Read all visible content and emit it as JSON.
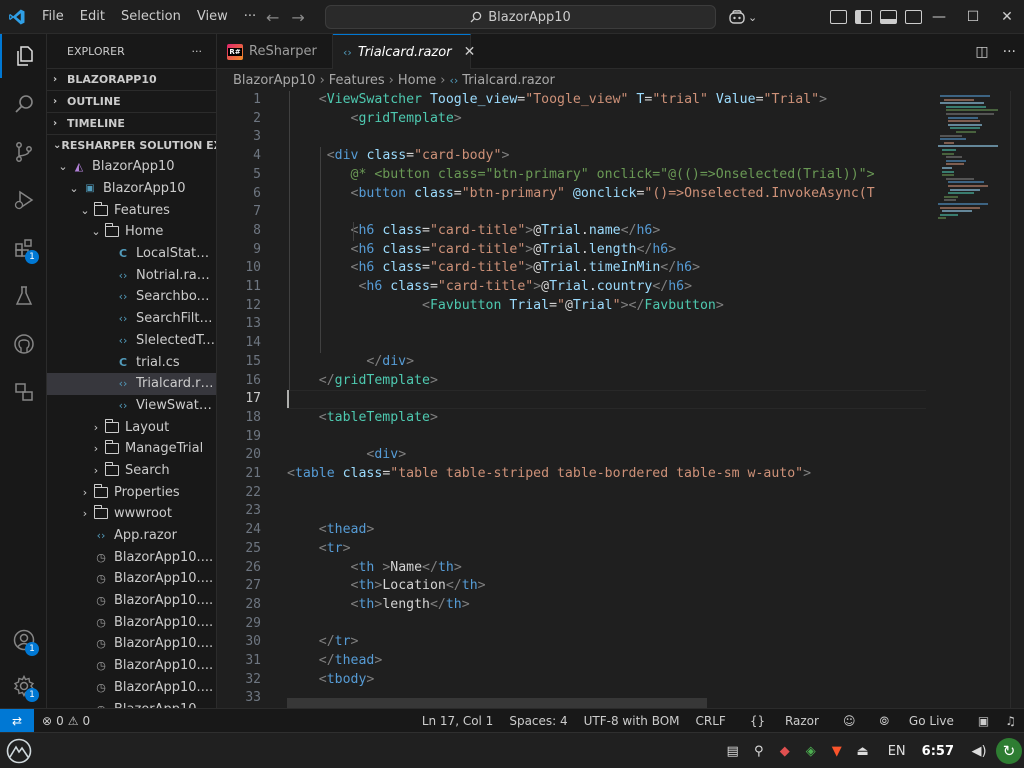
{
  "titlebar": {
    "menu": [
      "File",
      "Edit",
      "Selection",
      "View",
      "···"
    ],
    "search": "BlazorApp10"
  },
  "explorer": {
    "header": "EXPLORER",
    "sections": [
      "BLAZORAPP10",
      "OUTLINE",
      "TIMELINE",
      "RESHARPER SOLUTION EXPL..."
    ],
    "tree": [
      {
        "label": "BlazorApp10",
        "kind": "solution",
        "level": 1,
        "chev": "open"
      },
      {
        "label": "BlazorApp10",
        "kind": "project",
        "level": 2,
        "chev": "open"
      },
      {
        "label": "Features",
        "kind": "folder",
        "level": 3,
        "chev": "open"
      },
      {
        "label": "Home",
        "kind": "folder",
        "level": 4,
        "chev": "open"
      },
      {
        "label": "LocalState.cs",
        "kind": "cs",
        "level": 5
      },
      {
        "label": "Notrial.razor",
        "kind": "razor",
        "level": 5
      },
      {
        "label": "Searchbox....",
        "kind": "razor",
        "level": 5
      },
      {
        "label": "SearchFilte...",
        "kind": "razor",
        "level": 5
      },
      {
        "label": "SlelectedTr...",
        "kind": "razor",
        "level": 5
      },
      {
        "label": "trial.cs",
        "kind": "cs",
        "level": 5
      },
      {
        "label": "Trialcard.ra...",
        "kind": "razor",
        "level": 5,
        "selected": true
      },
      {
        "label": "ViewSwatc...",
        "kind": "razor",
        "level": 5
      },
      {
        "label": "Layout",
        "kind": "folder",
        "level": 4,
        "chev": "closed"
      },
      {
        "label": "ManageTrial",
        "kind": "folder",
        "level": 4,
        "chev": "closed"
      },
      {
        "label": "Search",
        "kind": "folder",
        "level": 4,
        "chev": "closed"
      },
      {
        "label": "Properties",
        "kind": "folder",
        "level": 3,
        "chev": "closed"
      },
      {
        "label": "wwwroot",
        "kind": "folder",
        "level": 3,
        "chev": "closed"
      },
      {
        "label": "App.razor",
        "kind": "razor",
        "level": 3
      },
      {
        "label": "BlazorApp10....",
        "kind": "clock",
        "level": 3
      },
      {
        "label": "BlazorApp10....",
        "kind": "clock",
        "level": 3
      },
      {
        "label": "BlazorApp10....",
        "kind": "clock",
        "level": 3
      },
      {
        "label": "BlazorApp10....",
        "kind": "clock",
        "level": 3
      },
      {
        "label": "BlazorApp10....",
        "kind": "clock",
        "level": 3
      },
      {
        "label": "BlazorApp10....",
        "kind": "clock",
        "level": 3
      },
      {
        "label": "BlazorApp10....",
        "kind": "clock",
        "level": 3
      },
      {
        "label": "BlazorApp10....",
        "kind": "clock",
        "level": 3
      }
    ]
  },
  "tabs": [
    {
      "label": "ReSharper",
      "active": false
    },
    {
      "label": "Trialcard.razor",
      "active": true
    }
  ],
  "breadcrumb": [
    "BlazorApp10",
    "Features",
    "Home",
    "Trialcard.razor"
  ],
  "editor": {
    "current_line": 17,
    "lines": [
      {
        "n": 1,
        "html": "    <span class='t'>&lt;</span><span class='tc'>ViewSwatcher</span> <span class='at'>Toogle_view</span><span class='pl'>=</span><span class='st'>\"Toogle_view\"</span> <span class='at'>T</span><span class='pl'>=</span><span class='st'>\"trial\"</span> <span class='at'>Value</span><span class='pl'>=</span><span class='st'>\"Trial\"</span><span class='t'>&gt;</span>"
      },
      {
        "n": 2,
        "html": "        <span class='t'>&lt;</span><span class='tc'>gridTemplate</span><span class='t'>&gt;</span>"
      },
      {
        "n": 3,
        "html": ""
      },
      {
        "n": 4,
        "html": "     <span class='t'>&lt;</span><span class='tn'>div</span> <span class='at'>class</span><span class='pl'>=</span><span class='st'>\"card-body\"</span><span class='t'>&gt;</span>"
      },
      {
        "n": 5,
        "html": "        <span class='cm'>@* &lt;button class=\"btn-primary\" onclick=\"@(()=&gt;Onselected(Trial))\"&gt;</span>"
      },
      {
        "n": 6,
        "html": "        <span class='t'>&lt;</span><span class='tn'>button</span> <span class='at'>class</span><span class='pl'>=</span><span class='st'>\"btn-primary\"</span> <span class='at'>@onclick</span><span class='pl'>=</span><span class='st'>\"()=&gt;Onselected.InvokeAsync(T</span>"
      },
      {
        "n": 7,
        "html": ""
      },
      {
        "n": 8,
        "html": "        <span class='t'>&lt;</span><span class='tn'>h6</span> <span class='at'>class</span><span class='pl'>=</span><span class='st'>\"card-title\"</span><span class='t'>&gt;</span><span class='pl'>@</span><span class='at'>Trial</span><span class='pl'>.</span><span class='at'>name</span><span class='t'>&lt;/</span><span class='tn'>h6</span><span class='t'>&gt;</span>"
      },
      {
        "n": 9,
        "html": "        <span class='t'>&lt;</span><span class='tn'>h6</span> <span class='at'>class</span><span class='pl'>=</span><span class='st'>\"card-title\"</span><span class='t'>&gt;</span><span class='pl'>@</span><span class='at'>Trial</span><span class='pl'>.</span><span class='at'>length</span><span class='t'>&lt;/</span><span class='tn'>h6</span><span class='t'>&gt;</span>"
      },
      {
        "n": 10,
        "html": "        <span class='t'>&lt;</span><span class='tn'>h6</span> <span class='at'>class</span><span class='pl'>=</span><span class='st'>\"card-title\"</span><span class='t'>&gt;</span><span class='pl'>@</span><span class='at'>Trial</span><span class='pl'>.</span><span class='at'>timeInMin</span><span class='t'>&lt;/</span><span class='tn'>h6</span><span class='t'>&gt;</span>"
      },
      {
        "n": 11,
        "html": "         <span class='t'>&lt;</span><span class='tn'>h6</span> <span class='at'>class</span><span class='pl'>=</span><span class='st'>\"card-title\"</span><span class='t'>&gt;</span><span class='pl'>@</span><span class='at'>Trial</span><span class='pl'>.</span><span class='at'>country</span><span class='t'>&lt;/</span><span class='tn'>h6</span><span class='t'>&gt;</span>"
      },
      {
        "n": 12,
        "html": "                 <span class='t'>&lt;</span><span class='tc'>Favbutton</span> <span class='at'>Trial</span><span class='pl'>=</span><span class='st'>\"</span><span class='pl'>@</span><span class='at'>Trial</span><span class='st'>\"</span><span class='t'>&gt;&lt;/</span><span class='tc'>Favbutton</span><span class='t'>&gt;</span>"
      },
      {
        "n": 13,
        "html": ""
      },
      {
        "n": 14,
        "html": ""
      },
      {
        "n": 15,
        "html": "          <span class='t'>&lt;/</span><span class='tn'>div</span><span class='t'>&gt;</span>"
      },
      {
        "n": 16,
        "html": "    <span class='t'>&lt;/</span><span class='tc'>gridTemplate</span><span class='t'>&gt;</span>"
      },
      {
        "n": 17,
        "html": ""
      },
      {
        "n": 18,
        "html": "    <span class='t'>&lt;</span><span class='tc'>tableTemplate</span><span class='t'>&gt;</span>"
      },
      {
        "n": 19,
        "html": ""
      },
      {
        "n": 20,
        "html": "          <span class='t'>&lt;</span><span class='tn'>div</span><span class='t'>&gt;</span>"
      },
      {
        "n": 21,
        "html": "<span class='t'>&lt;</span><span class='tn'>table</span> <span class='at'>class</span><span class='pl'>=</span><span class='st'>\"table table-striped table-bordered table-sm w-auto\"</span><span class='t'>&gt;</span>"
      },
      {
        "n": 22,
        "html": ""
      },
      {
        "n": 23,
        "html": ""
      },
      {
        "n": 24,
        "html": "    <span class='t'>&lt;</span><span class='tn'>thead</span><span class='t'>&gt;</span>"
      },
      {
        "n": 25,
        "html": "    <span class='t'>&lt;</span><span class='tn'>tr</span><span class='t'>&gt;</span>"
      },
      {
        "n": 26,
        "html": "        <span class='t'>&lt;</span><span class='tn'>th</span> <span class='t'>&gt;</span><span class='pl'>Name</span><span class='t'>&lt;/</span><span class='tn'>th</span><span class='t'>&gt;</span>"
      },
      {
        "n": 27,
        "html": "        <span class='t'>&lt;</span><span class='tn'>th</span><span class='t'>&gt;</span><span class='pl'>Location</span><span class='t'>&lt;/</span><span class='tn'>th</span><span class='t'>&gt;</span>"
      },
      {
        "n": 28,
        "html": "        <span class='t'>&lt;</span><span class='tn'>th</span><span class='t'>&gt;</span><span class='pl'>length</span><span class='t'>&lt;/</span><span class='tn'>th</span><span class='t'>&gt;</span>"
      },
      {
        "n": 29,
        "html": ""
      },
      {
        "n": 30,
        "html": "    <span class='t'>&lt;/</span><span class='tn'>tr</span><span class='t'>&gt;</span>"
      },
      {
        "n": 31,
        "html": "    <span class='t'>&lt;/</span><span class='tn'>thead</span><span class='t'>&gt;</span>"
      },
      {
        "n": 32,
        "html": "    <span class='t'>&lt;</span><span class='tn'>tbody</span><span class='t'>&gt;</span>"
      },
      {
        "n": 33,
        "html": ""
      }
    ]
  },
  "statusbar": {
    "errors": "0",
    "warnings": "0",
    "position": "Ln 17, Col 1",
    "spaces": "Spaces: 4",
    "encoding": "UTF-8 with BOM",
    "eol": "CRLF",
    "language": "Razor",
    "golive": "Go Live"
  },
  "activity_badges": {
    "extensions": "1",
    "accounts": "1",
    "settings": "1"
  },
  "taskbar": {
    "lang": "EN",
    "time": "6:57"
  },
  "colors": {
    "accent": "#0078d4",
    "background": "#1f1f1f",
    "sidebar": "#181818"
  }
}
